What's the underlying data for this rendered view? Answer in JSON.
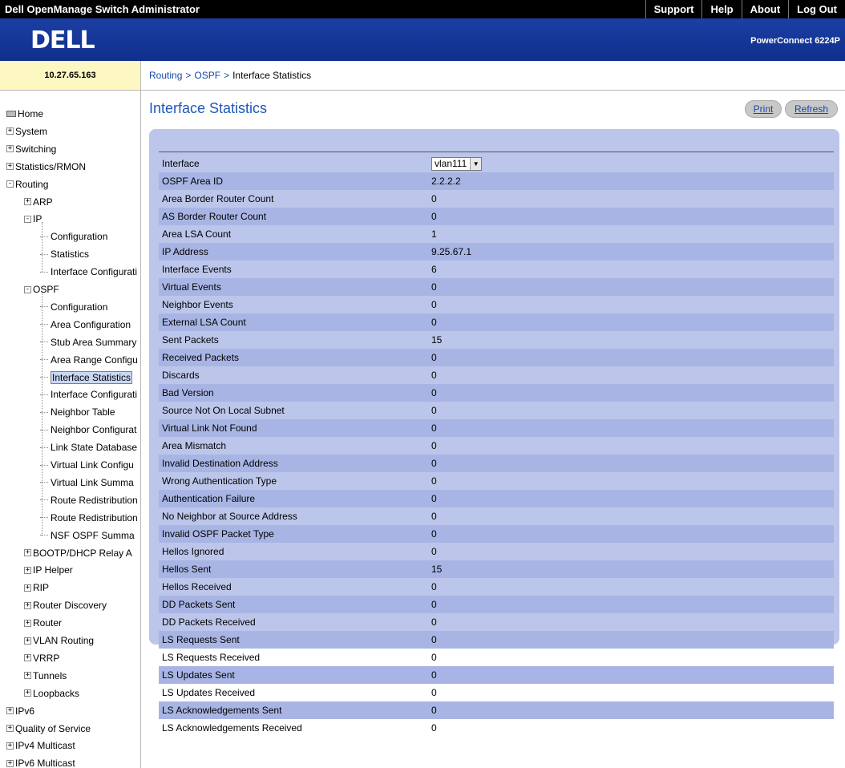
{
  "app": {
    "title": "Dell OpenManage Switch Administrator",
    "nav": [
      "Support",
      "Help",
      "About",
      "Log Out"
    ],
    "logo": "DELL",
    "model": "PowerConnect 6224P",
    "ip": "10.27.65.163"
  },
  "breadcrumb": [
    "Routing",
    "OSPF",
    "Interface Statistics"
  ],
  "sidebar": [
    {
      "label": "Home",
      "indent": 0,
      "icon": "home",
      "expander": ""
    },
    {
      "label": "System",
      "indent": 0,
      "icon": "",
      "expander": "+"
    },
    {
      "label": "Switching",
      "indent": 0,
      "icon": "",
      "expander": "+"
    },
    {
      "label": "Statistics/RMON",
      "indent": 0,
      "icon": "",
      "expander": "+"
    },
    {
      "label": "Routing",
      "indent": 0,
      "icon": "",
      "expander": "-"
    },
    {
      "label": "ARP",
      "indent": 1,
      "icon": "",
      "expander": "+"
    },
    {
      "label": "IP",
      "indent": 1,
      "icon": "",
      "expander": "-"
    },
    {
      "label": "Configuration",
      "indent": 2,
      "icon": "leaf",
      "expander": ""
    },
    {
      "label": "Statistics",
      "indent": 2,
      "icon": "leaf",
      "expander": ""
    },
    {
      "label": "Interface Configurati",
      "indent": 2,
      "icon": "leaf",
      "expander": ""
    },
    {
      "label": "OSPF",
      "indent": 1,
      "icon": "",
      "expander": "-"
    },
    {
      "label": "Configuration",
      "indent": 2,
      "icon": "leaf",
      "expander": ""
    },
    {
      "label": "Area Configuration",
      "indent": 2,
      "icon": "leaf",
      "expander": ""
    },
    {
      "label": "Stub Area Summary",
      "indent": 2,
      "icon": "leaf",
      "expander": ""
    },
    {
      "label": "Area Range Configu",
      "indent": 2,
      "icon": "leaf",
      "expander": ""
    },
    {
      "label": "Interface Statistics",
      "indent": 2,
      "icon": "leaf",
      "expander": "",
      "selected": true
    },
    {
      "label": "Interface Configurati",
      "indent": 2,
      "icon": "leaf",
      "expander": ""
    },
    {
      "label": "Neighbor Table",
      "indent": 2,
      "icon": "leaf",
      "expander": ""
    },
    {
      "label": "Neighbor Configurat",
      "indent": 2,
      "icon": "leaf",
      "expander": ""
    },
    {
      "label": "Link State Database",
      "indent": 2,
      "icon": "leaf",
      "expander": ""
    },
    {
      "label": "Virtual Link Configu",
      "indent": 2,
      "icon": "leaf",
      "expander": ""
    },
    {
      "label": "Virtual Link Summa",
      "indent": 2,
      "icon": "leaf",
      "expander": ""
    },
    {
      "label": "Route Redistribution",
      "indent": 2,
      "icon": "leaf",
      "expander": ""
    },
    {
      "label": "Route Redistribution",
      "indent": 2,
      "icon": "leaf",
      "expander": ""
    },
    {
      "label": "NSF OSPF Summa",
      "indent": 2,
      "icon": "leaf",
      "expander": ""
    },
    {
      "label": "BOOTP/DHCP Relay A",
      "indent": 1,
      "icon": "",
      "expander": "+"
    },
    {
      "label": "IP Helper",
      "indent": 1,
      "icon": "",
      "expander": "+"
    },
    {
      "label": "RIP",
      "indent": 1,
      "icon": "",
      "expander": "+"
    },
    {
      "label": "Router Discovery",
      "indent": 1,
      "icon": "",
      "expander": "+"
    },
    {
      "label": "Router",
      "indent": 1,
      "icon": "",
      "expander": "+"
    },
    {
      "label": "VLAN Routing",
      "indent": 1,
      "icon": "",
      "expander": "+"
    },
    {
      "label": "VRRP",
      "indent": 1,
      "icon": "",
      "expander": "+"
    },
    {
      "label": "Tunnels",
      "indent": 1,
      "icon": "",
      "expander": "+"
    },
    {
      "label": "Loopbacks",
      "indent": 1,
      "icon": "",
      "expander": "+"
    },
    {
      "label": "IPv6",
      "indent": 0,
      "icon": "",
      "expander": "+"
    },
    {
      "label": "Quality of Service",
      "indent": 0,
      "icon": "",
      "expander": "+"
    },
    {
      "label": "IPv4 Multicast",
      "indent": 0,
      "icon": "",
      "expander": "+"
    },
    {
      "label": "IPv6 Multicast",
      "indent": 0,
      "icon": "",
      "expander": "+"
    }
  ],
  "page": {
    "title": "Interface Statistics",
    "print_label": "Print",
    "refresh_label": "Refresh"
  },
  "interface_select": {
    "label": "Interface",
    "value": "vlan111"
  },
  "stats": [
    {
      "label": "OSPF Area ID",
      "value": "2.2.2.2"
    },
    {
      "label": "Area Border Router Count",
      "value": "0"
    },
    {
      "label": "AS Border Router Count",
      "value": "0"
    },
    {
      "label": "Area LSA Count",
      "value": "1"
    },
    {
      "label": "IP Address",
      "value": "9.25.67.1"
    },
    {
      "label": "Interface Events",
      "value": "6"
    },
    {
      "label": "Virtual Events",
      "value": "0"
    },
    {
      "label": "Neighbor Events",
      "value": "0"
    },
    {
      "label": "External LSA Count",
      "value": "0"
    },
    {
      "label": "Sent Packets",
      "value": "15"
    },
    {
      "label": "Received Packets",
      "value": "0"
    },
    {
      "label": "Discards",
      "value": "0"
    },
    {
      "label": "Bad Version",
      "value": "0"
    },
    {
      "label": "Source Not On Local Subnet",
      "value": "0"
    },
    {
      "label": "Virtual Link Not Found",
      "value": "0"
    },
    {
      "label": "Area Mismatch",
      "value": "0"
    },
    {
      "label": "Invalid Destination Address",
      "value": "0"
    },
    {
      "label": "Wrong Authentication Type",
      "value": "0"
    },
    {
      "label": "Authentication Failure",
      "value": "0"
    },
    {
      "label": "No Neighbor at Source Address",
      "value": "0"
    },
    {
      "label": "Invalid OSPF Packet Type",
      "value": "0"
    },
    {
      "label": "Hellos Ignored",
      "value": "0"
    },
    {
      "label": "Hellos Sent",
      "value": "15"
    },
    {
      "label": "Hellos Received",
      "value": "0"
    },
    {
      "label": "DD Packets Sent",
      "value": "0"
    },
    {
      "label": "DD Packets Received",
      "value": "0"
    },
    {
      "label": "LS Requests Sent",
      "value": "0"
    },
    {
      "label": "LS Requests Received",
      "value": "0"
    },
    {
      "label": "LS Updates Sent",
      "value": "0"
    },
    {
      "label": "LS Updates Received",
      "value": "0"
    },
    {
      "label": "LS Acknowledgements Sent",
      "value": "0"
    },
    {
      "label": "LS Acknowledgements Received",
      "value": "0"
    }
  ],
  "colors": {
    "banner": "#1c3fa4",
    "ip_strip": "#fdf7c2",
    "panel": "#bcc6ea",
    "row_alt": "#a8b5e4",
    "title_blue": "#1e58b8"
  }
}
